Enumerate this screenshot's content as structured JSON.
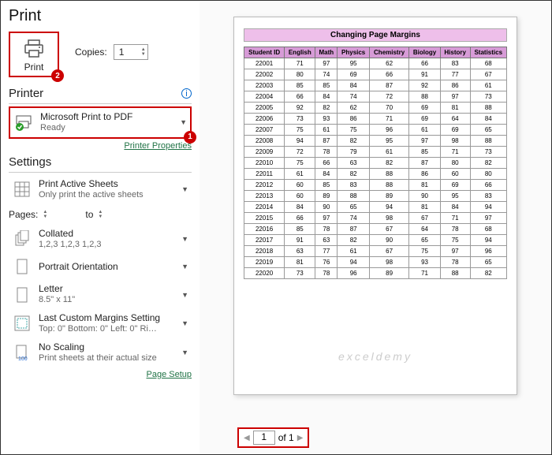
{
  "title": "Print",
  "print_button": "Print",
  "copies_label": "Copies:",
  "copies_value": "1",
  "printer_heading": "Printer",
  "printer": {
    "name": "Microsoft Print to PDF",
    "status": "Ready"
  },
  "printer_props_link": "Printer Properties",
  "settings_heading": "Settings",
  "print_active": {
    "main": "Print Active Sheets",
    "sub": "Only print the active sheets"
  },
  "pages_label": "Pages:",
  "pages_to": "to",
  "collated": {
    "main": "Collated",
    "sub": "1,2,3   1,2,3   1,2,3"
  },
  "orientation": {
    "main": "Portrait Orientation"
  },
  "paper": {
    "main": "Letter",
    "sub": "8.5\" x 11\""
  },
  "margins": {
    "main": "Last Custom Margins Setting",
    "sub": "Top: 0\" Bottom: 0\" Left: 0\" Ri…"
  },
  "scaling": {
    "main": "No Scaling",
    "sub": "Print sheets at their actual size"
  },
  "page_setup_link": "Page Setup",
  "preview_title": "Changing Page Margins",
  "watermark": "exceldemy",
  "pager": {
    "current": "1",
    "of": "of 1"
  },
  "chart_data": {
    "type": "table",
    "headers": [
      "Student ID",
      "English",
      "Math",
      "Physics",
      "Chemistry",
      "Biology",
      "History",
      "Statistics"
    ],
    "rows": [
      [
        "22001",
        "71",
        "97",
        "95",
        "62",
        "66",
        "83",
        "68"
      ],
      [
        "22002",
        "80",
        "74",
        "69",
        "66",
        "91",
        "77",
        "67"
      ],
      [
        "22003",
        "85",
        "85",
        "84",
        "87",
        "92",
        "86",
        "61"
      ],
      [
        "22004",
        "66",
        "84",
        "74",
        "72",
        "88",
        "97",
        "73"
      ],
      [
        "22005",
        "92",
        "82",
        "62",
        "70",
        "69",
        "81",
        "88"
      ],
      [
        "22006",
        "73",
        "93",
        "86",
        "71",
        "69",
        "64",
        "84"
      ],
      [
        "22007",
        "75",
        "61",
        "75",
        "96",
        "61",
        "69",
        "65"
      ],
      [
        "22008",
        "94",
        "87",
        "82",
        "95",
        "97",
        "98",
        "88"
      ],
      [
        "22009",
        "72",
        "78",
        "79",
        "61",
        "85",
        "71",
        "73"
      ],
      [
        "22010",
        "75",
        "66",
        "63",
        "82",
        "87",
        "80",
        "82"
      ],
      [
        "22011",
        "61",
        "84",
        "82",
        "88",
        "86",
        "60",
        "80"
      ],
      [
        "22012",
        "60",
        "85",
        "83",
        "88",
        "81",
        "69",
        "66"
      ],
      [
        "22013",
        "60",
        "89",
        "88",
        "89",
        "90",
        "95",
        "83"
      ],
      [
        "22014",
        "84",
        "90",
        "65",
        "94",
        "81",
        "84",
        "94"
      ],
      [
        "22015",
        "66",
        "97",
        "74",
        "98",
        "67",
        "71",
        "97"
      ],
      [
        "22016",
        "85",
        "78",
        "87",
        "67",
        "64",
        "78",
        "68"
      ],
      [
        "22017",
        "91",
        "63",
        "82",
        "90",
        "65",
        "75",
        "94"
      ],
      [
        "22018",
        "63",
        "77",
        "61",
        "67",
        "75",
        "97",
        "96"
      ],
      [
        "22019",
        "81",
        "76",
        "94",
        "98",
        "93",
        "78",
        "65"
      ],
      [
        "22020",
        "73",
        "78",
        "96",
        "89",
        "71",
        "88",
        "82"
      ]
    ]
  }
}
